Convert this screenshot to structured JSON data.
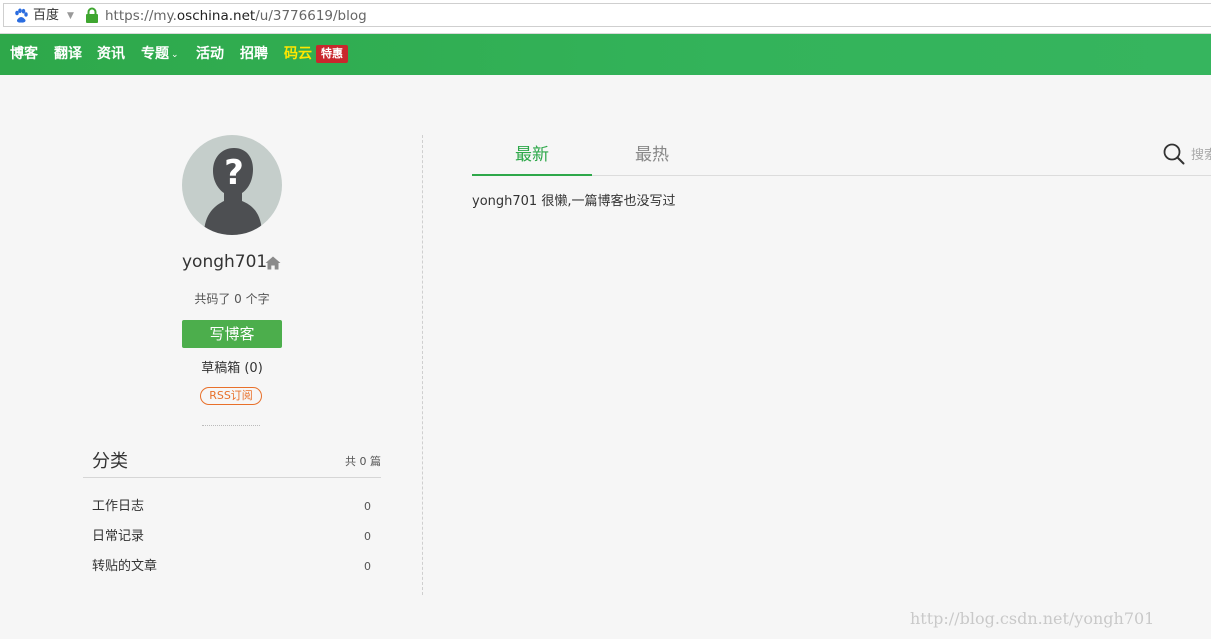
{
  "browser": {
    "search_engine": "百度",
    "url_scheme": "https://my.",
    "url_domain": "oschina.net",
    "url_path": "/u/3776619/blog"
  },
  "nav": {
    "items": [
      "博客",
      "翻译",
      "资讯",
      "专题",
      "活动",
      "招聘"
    ],
    "special": "码云",
    "badge": "特惠",
    "dropdown_glyph": "⌄"
  },
  "profile": {
    "username": "yongh701",
    "wordcount": "共码了 0 个字",
    "write_button": "写博客",
    "drafts": "草稿箱 (0)",
    "rss": "RSS订阅"
  },
  "categories": {
    "title": "分类",
    "total": "共 0 篇",
    "items": [
      {
        "name": "工作日志",
        "count": "0"
      },
      {
        "name": "日常记录",
        "count": "0"
      },
      {
        "name": "转贴的文章",
        "count": "0"
      }
    ]
  },
  "main": {
    "tabs": [
      "最新",
      "最热"
    ],
    "search_placeholder": "搜索",
    "empty_message": "yongh701 很懒,一篇博客也没写过"
  },
  "watermark": "http://blog.csdn.net/yongh701",
  "colors": {
    "nav_green": "#33b35a",
    "accent_green": "#2ea84a",
    "button_green": "#4cae4c",
    "badge_red": "#c9272d",
    "gitee_yellow": "#ffe600",
    "rss_orange": "#e8702a"
  }
}
